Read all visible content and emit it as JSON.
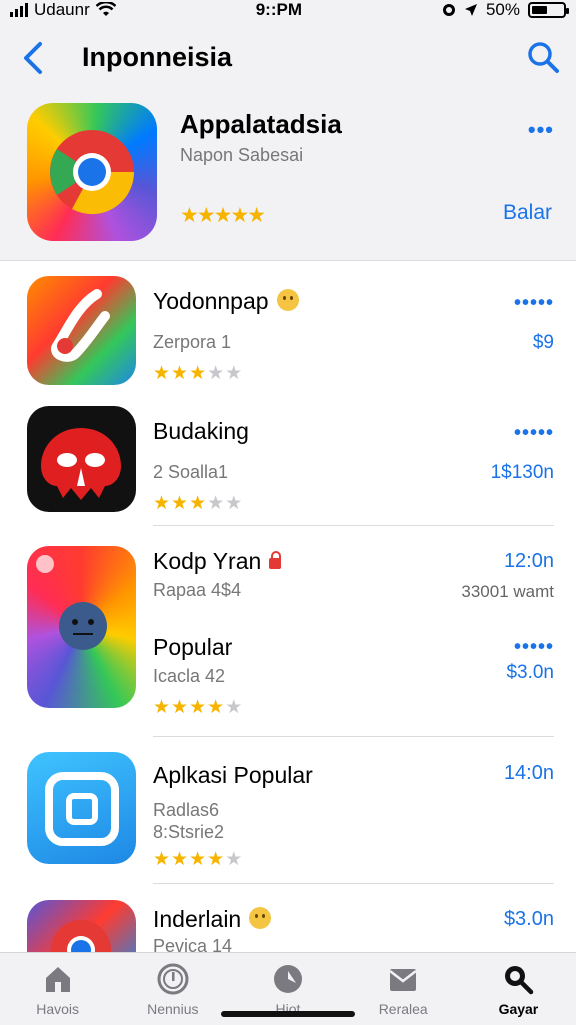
{
  "status": {
    "carrier": "Udaunr",
    "time": "9::PM",
    "battery": "50%",
    "battery_level": 0.5
  },
  "navbar": {
    "title": "Inponneisia",
    "back_icon": "chevron-left-icon",
    "search_icon": "search-icon"
  },
  "featured": {
    "title": "Appalatadsia",
    "subtitle": "Napon Sabesai",
    "stars_text": "★★★★★",
    "more": "•••",
    "action": "Balar"
  },
  "apps": [
    {
      "name": "Yodonnpap",
      "subtitle": "Zerpora 1",
      "rating": 3,
      "right_top": "•••••",
      "right_bottom": "$9",
      "badge": "emoji"
    },
    {
      "name": "Budaking",
      "subtitle": "2 Soalla1",
      "rating": 3,
      "right_top": "•••••",
      "right_bottom": "1$130n",
      "badge": ""
    },
    {
      "name": "Kodp Yran",
      "subtitle": "Rapaa 4$4",
      "rating": 0,
      "right_top": "12:0n",
      "right_bottom": "33001 wamt",
      "badge": "lock"
    },
    {
      "name": "Popular",
      "subtitle": "Icacla 42",
      "rating": 4,
      "right_top": "•••••",
      "right_bottom": "$3.0n",
      "badge": ""
    },
    {
      "name": "Aplkasi Popular",
      "subtitle": "Radlas6",
      "subtitle2": "8:Stsrie2",
      "rating": 4,
      "right_top": "14:0n",
      "right_bottom": "",
      "badge": ""
    },
    {
      "name": "Inderlain",
      "subtitle": "Pevica 14",
      "rating": 0,
      "right_top": "$3.0n",
      "right_bottom": "",
      "badge": "emoji"
    }
  ],
  "tabs": [
    {
      "label": "Havois",
      "icon": "house-icon"
    },
    {
      "label": "Nennius",
      "icon": "clock-icon"
    },
    {
      "label": "Hiot",
      "icon": "compass-icon"
    },
    {
      "label": "Reralea",
      "icon": "mail-icon"
    },
    {
      "label": "Gayar",
      "icon": "search-icon",
      "active": true
    }
  ],
  "colors": {
    "accent": "#1a73e8",
    "star": "#f6b400",
    "bar_bg": "#f2f2f4"
  }
}
